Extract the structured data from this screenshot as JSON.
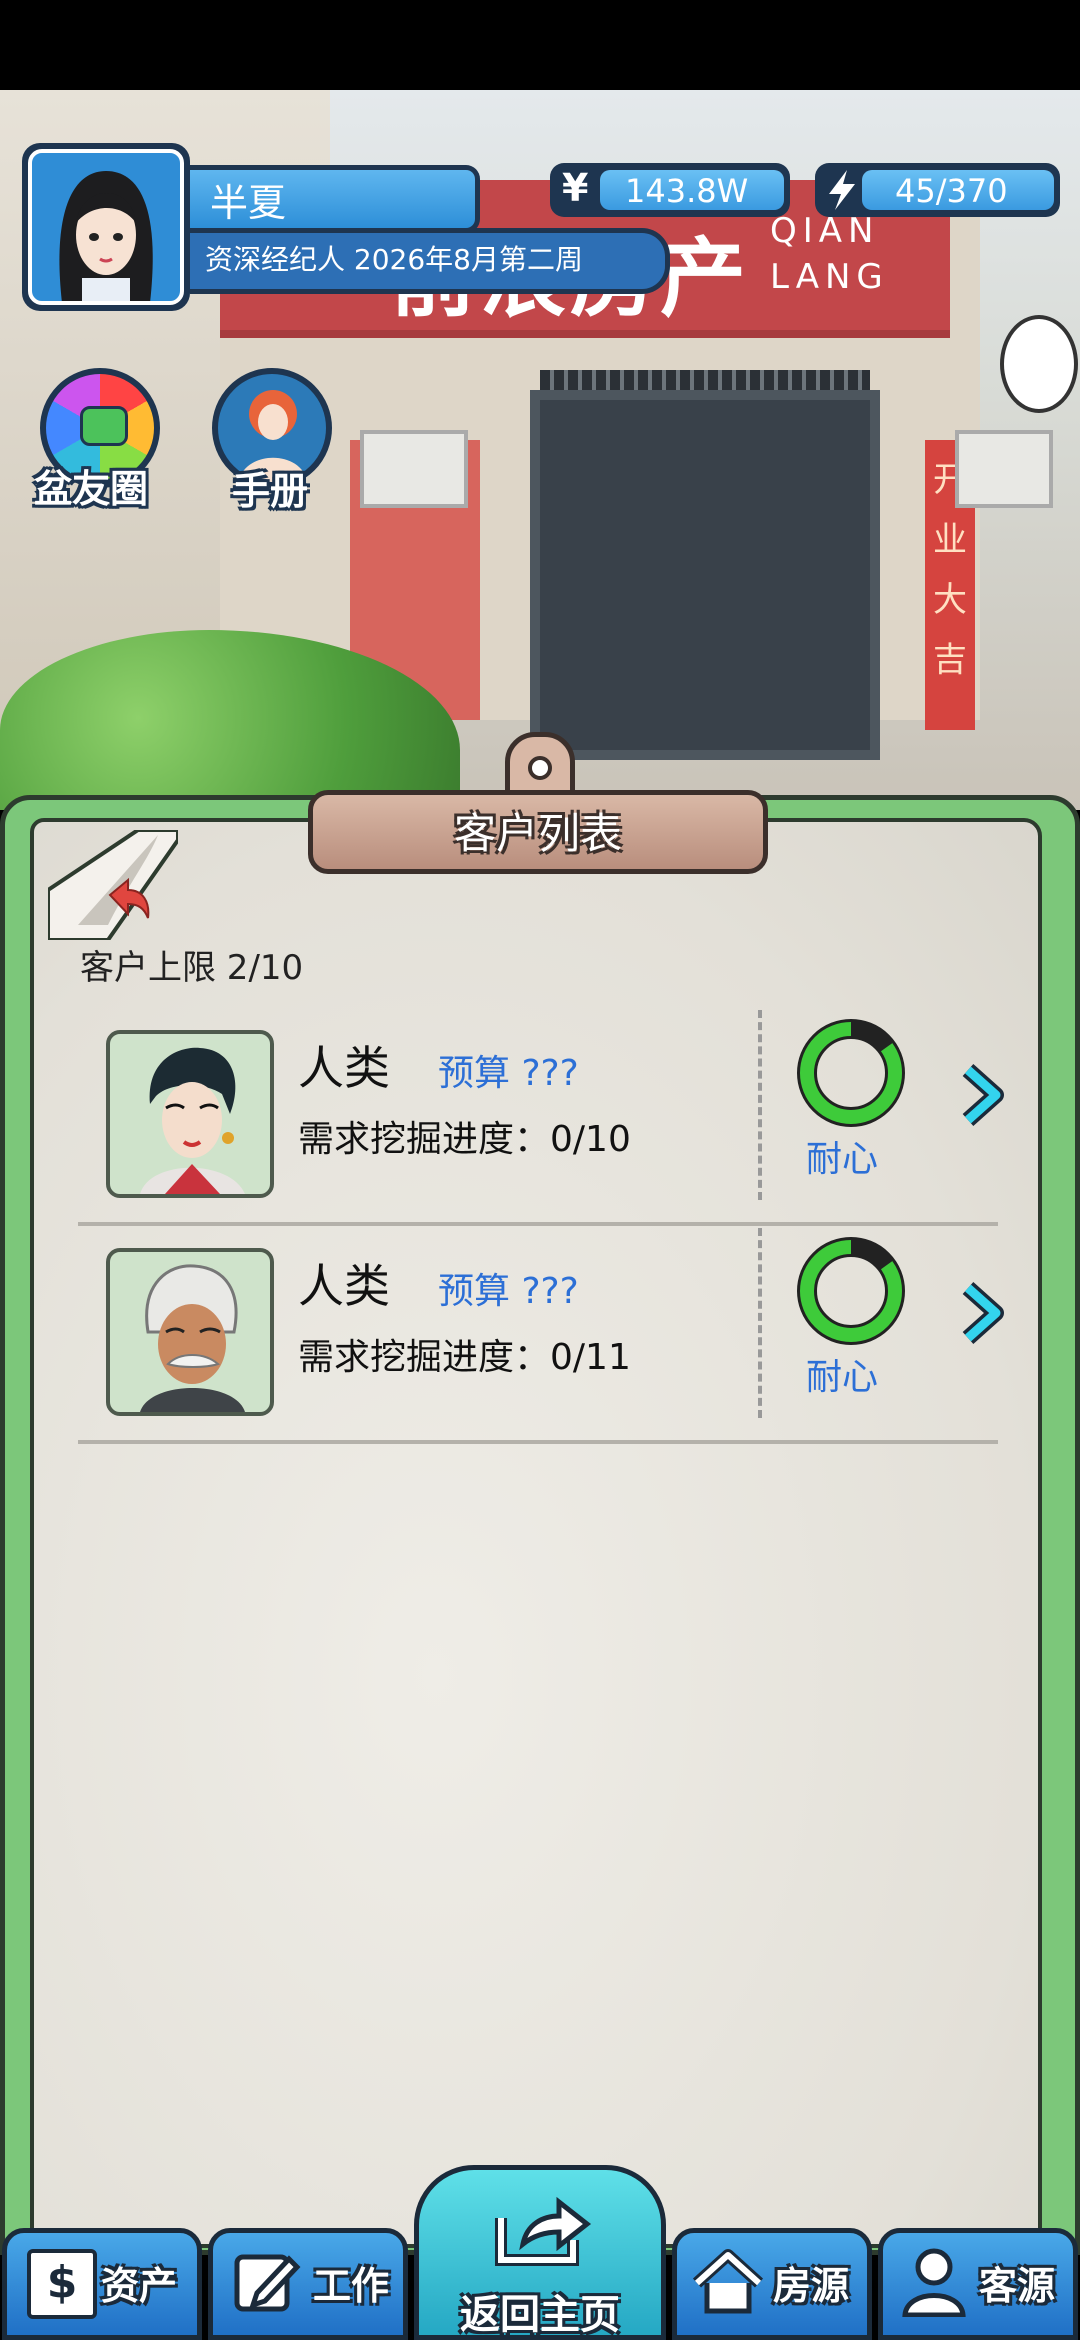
{
  "player": {
    "name": "半夏",
    "title": "资深经纪人 2026年8月第二周",
    "money_symbol": "¥",
    "money": "143.8W",
    "energy": "45/370"
  },
  "scene": {
    "shop_sign_cn": "前浪房产",
    "shop_sign_en_1": "QIAN",
    "shop_sign_en_2": "LANG",
    "banner": "开业大吉"
  },
  "shortcuts": {
    "friends_label": "盆友圈",
    "handbook_label": "手册"
  },
  "panel": {
    "title": "客户列表",
    "limit_text": "客户上限 2/10",
    "customers": [
      {
        "name": "人类",
        "budget": "预算 ???",
        "progress": "需求挖掘进度：0/10",
        "patience_label": "耐心",
        "patience": 0.85
      },
      {
        "name": "人类",
        "budget": "预算 ???",
        "progress": "需求挖掘进度：0/11",
        "patience_label": "耐心",
        "patience": 0.85
      }
    ]
  },
  "nav": {
    "assets": "资产",
    "work": "工作",
    "home": "返回主页",
    "houses": "房源",
    "clients": "客源"
  },
  "colors": {
    "accent_blue": "#2d8fd8",
    "panel_green": "#7cc77a",
    "patience_green": "#3ecb3a",
    "budget_blue": "#2c6fd6"
  }
}
